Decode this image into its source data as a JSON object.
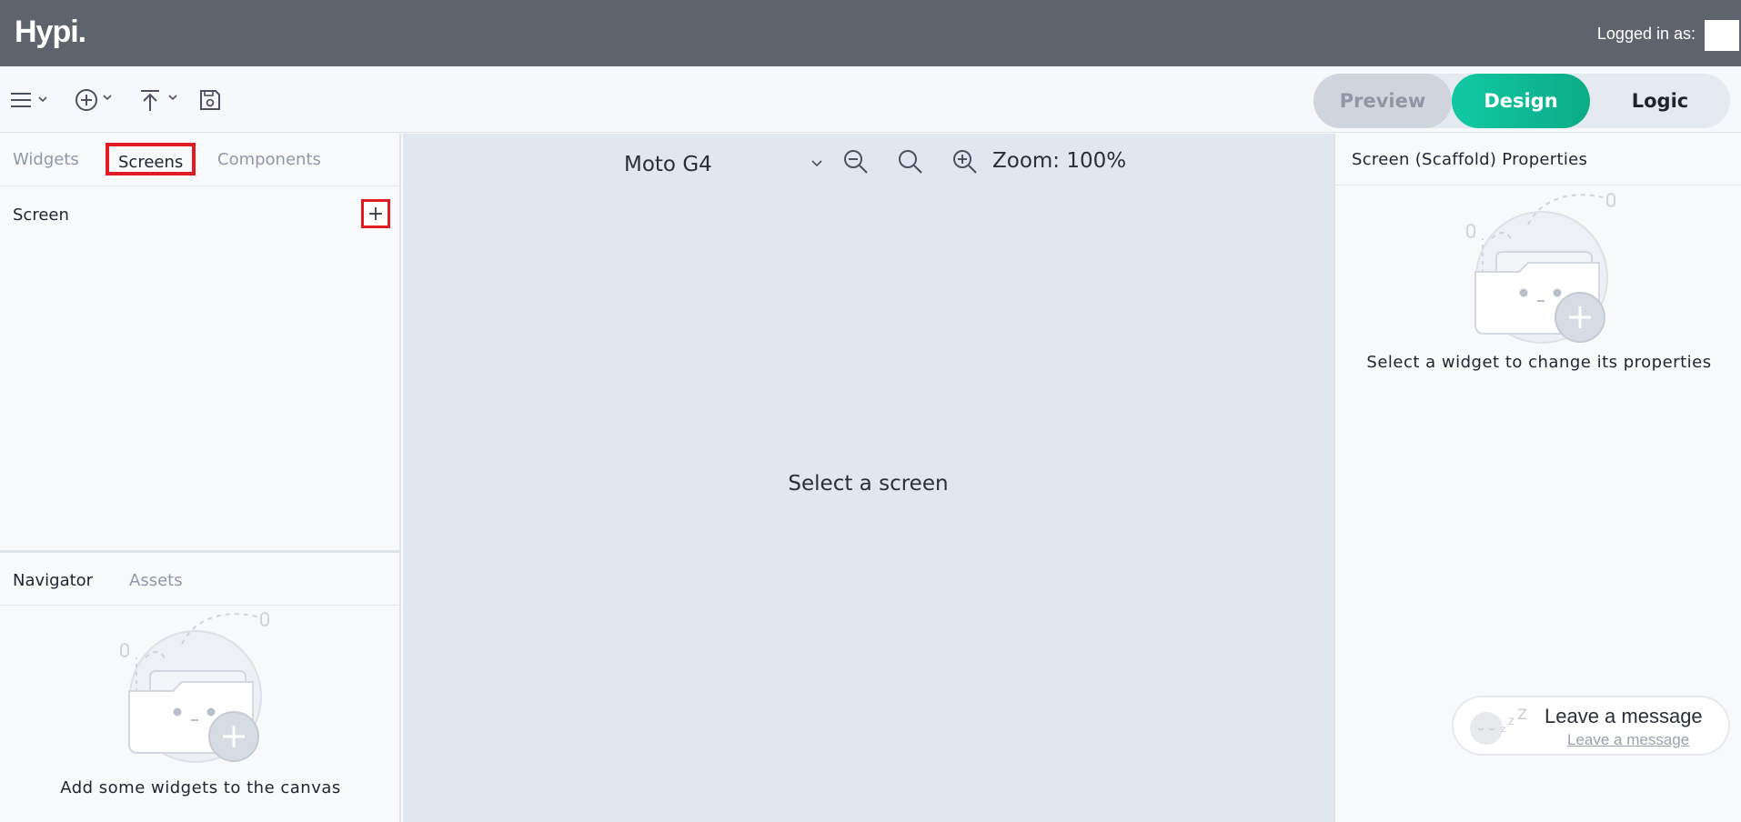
{
  "header": {
    "logo": "Hypi.",
    "logged_in_label": "Logged in as:"
  },
  "toolbar": {
    "menu_icon": "hamburger-icon",
    "add_icon": "plus-circle-icon",
    "publish_icon": "upload-icon",
    "save_icon": "save-icon",
    "modes": {
      "preview": "Preview",
      "design": "Design",
      "logic": "Logic"
    },
    "accent": "#0fbf9a"
  },
  "left_panel": {
    "tabs": [
      "Widgets",
      "Screens",
      "Components"
    ],
    "active_tab": "Screens",
    "screen_label": "Screen",
    "add_screen_symbol": "+",
    "lower_tabs": [
      "Navigator",
      "Assets"
    ],
    "empty_text": "Add some widgets to the canvas"
  },
  "canvas": {
    "device": "Moto G4",
    "zoom_label": "Zoom: 100%",
    "placeholder": "Select a screen"
  },
  "right_panel": {
    "title": "Screen (Scaffold) Properties",
    "empty_text": "Select a widget to change its properties"
  },
  "chat": {
    "title": "Leave a message",
    "subtitle": "Leave a message"
  }
}
